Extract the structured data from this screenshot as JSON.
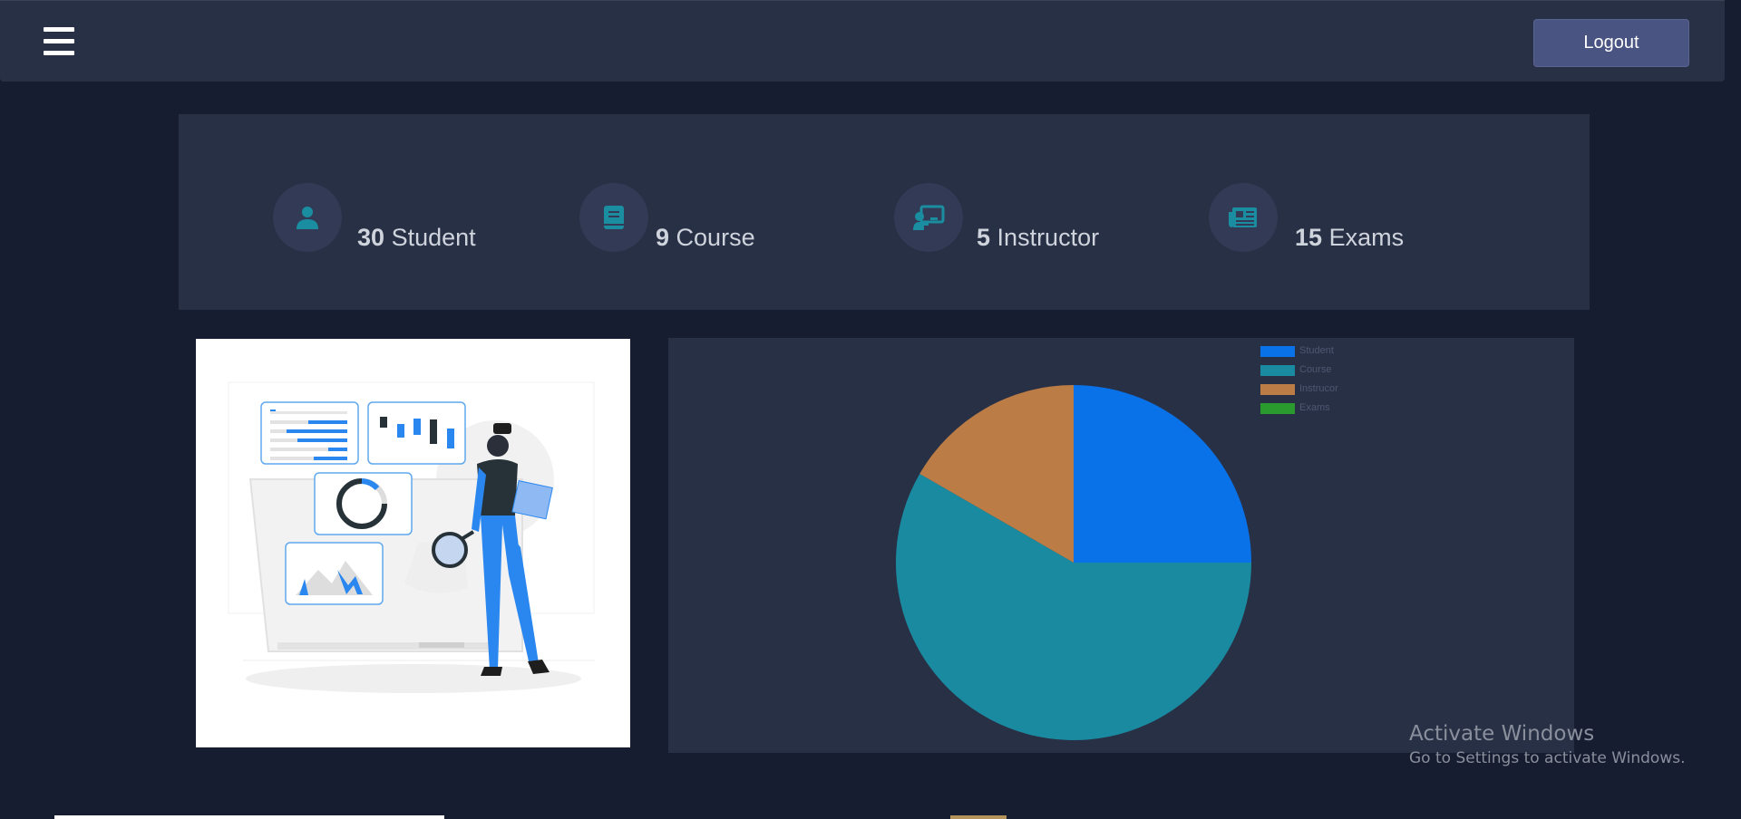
{
  "header": {
    "menu_icon": "hamburger-menu-icon",
    "logout_label": "Logout"
  },
  "stats": [
    {
      "icon": "user-icon",
      "count": "30",
      "label": "Student"
    },
    {
      "icon": "book-icon",
      "count": "9",
      "label": "Course"
    },
    {
      "icon": "chalkboard-teacher-icon",
      "count": "5",
      "label": "Instructor"
    },
    {
      "icon": "newspaper-icon",
      "count": "15",
      "label": "Exams"
    }
  ],
  "illustration": {
    "icon": "data-analysis-illustration"
  },
  "colors": {
    "background": "#161d31",
    "card": "#283046",
    "icon_accent": "#1a8ea0",
    "logout_button": "#4a5482"
  },
  "chart_data": {
    "type": "pie",
    "categories": [
      "Student",
      "Course",
      "Instrucor",
      "Exams"
    ],
    "values": [
      30,
      70,
      20,
      0
    ],
    "colors": [
      "#0a72e8",
      "#1a8aa0",
      "#bb7c45",
      "#2a9a2e"
    ],
    "legend_position": "top-right"
  },
  "watermark": {
    "title": "Activate Windows",
    "subtitle": "Go to Settings to activate Windows."
  }
}
